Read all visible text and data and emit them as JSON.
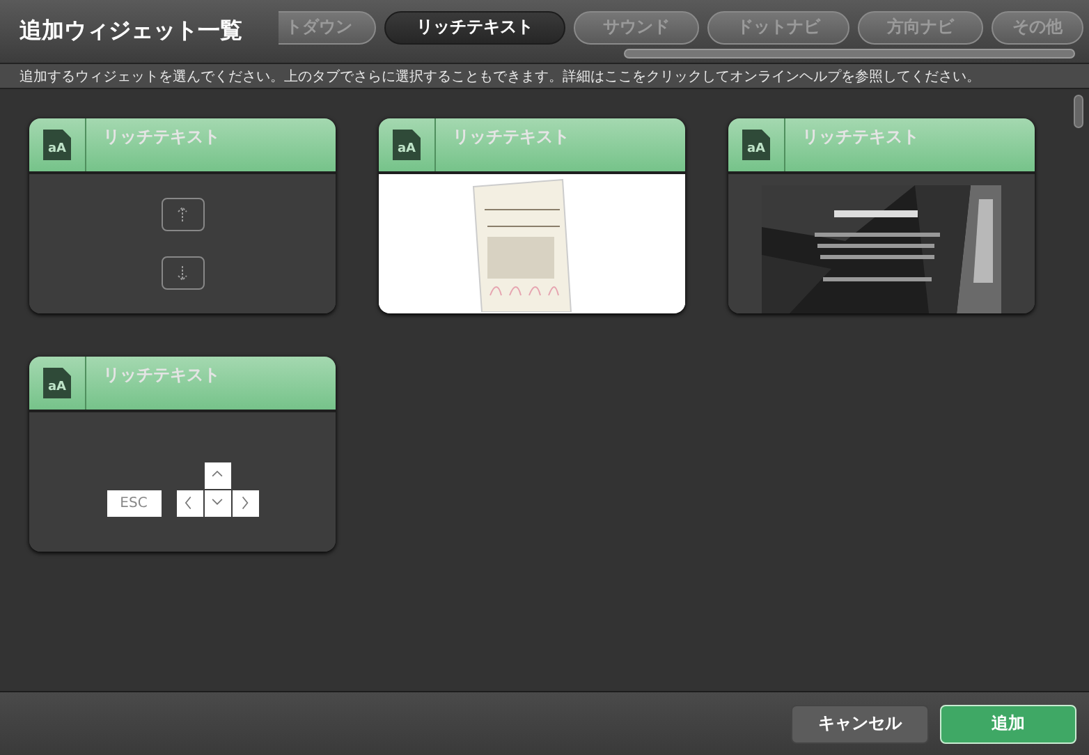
{
  "window": {
    "title": "追加ウィジェット一覧"
  },
  "tabs": [
    {
      "label": "トダウン",
      "selected": false
    },
    {
      "label": "リッチテキスト",
      "selected": true
    },
    {
      "label": "サウンド",
      "selected": false
    },
    {
      "label": "ドットナビ",
      "selected": false
    },
    {
      "label": "方向ナビ",
      "selected": false
    },
    {
      "label": "その他",
      "selected": false
    }
  ],
  "help_text": "追加するウィジェットを選んでください。上のタブでさらに選択することもできます。詳細はここをクリックしてオンラインヘルプを参照してください。",
  "widgets": [
    {
      "icon_label": "aA",
      "title": "リッチテキスト",
      "kind": "arrows"
    },
    {
      "icon_label": "aA",
      "title": "リッチテキスト",
      "kind": "paper"
    },
    {
      "icon_label": "aA",
      "title": "リッチテキスト"
    },
    {
      "icon_label": "aA",
      "title": "リッチテキスト",
      "kind": "keys",
      "key_label": "ESC"
    }
  ],
  "buttons": [
    {
      "label": "キャンセル",
      "kind": "secondary"
    },
    {
      "label": "追加",
      "kind": "primary"
    }
  ]
}
